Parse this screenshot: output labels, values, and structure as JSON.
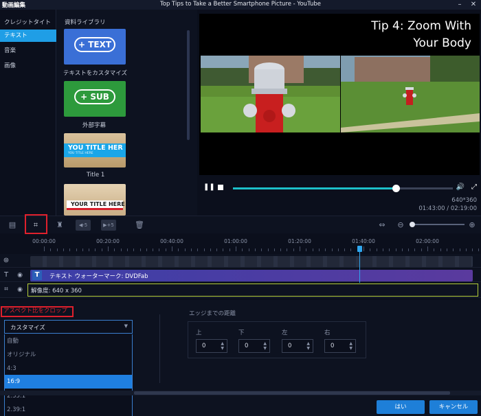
{
  "window": {
    "app_title": "動画編集",
    "title": "Top Tips to Take a Better Smartphone Picture - YouTube"
  },
  "sidebar": {
    "items": [
      {
        "label": "クレジットタイトル"
      },
      {
        "label": "テキスト"
      },
      {
        "label": "音楽"
      },
      {
        "label": "画像"
      }
    ],
    "active_index": 1
  },
  "library": {
    "header": "資料ライブラリ",
    "tiles": [
      {
        "pill": "+ TEXT",
        "caption": "テキストをカスタマイズ"
      },
      {
        "pill": "+ SUB",
        "caption": "外部字幕"
      },
      {
        "main": "YOU TITLE HER",
        "sub": "YOU TITLE HERE",
        "caption": "Title 1"
      },
      {
        "main": "YOUR TITLE HERE"
      }
    ]
  },
  "preview": {
    "overlay_line1": "Tip 4: Zoom With",
    "overlay_line2": "Your Body",
    "resolution": "640*360",
    "time": "01:43:00 / 02:19:00",
    "progress": 0.74
  },
  "timeline": {
    "ticks": [
      "00:00:00",
      "00:20:00",
      "00:40:00",
      "01:00:00",
      "01:20:00",
      "01:40:00",
      "02:00:00"
    ],
    "text_track_label": "テキスト ウォーターマーク: DVDFab",
    "crop_track_label": "解像度: 640 x 360",
    "zoom": 0
  },
  "crop": {
    "title": "アスペクト比をクロップ",
    "dropdown_value": "カスタマイズ",
    "options": [
      "自動",
      "オリジナル",
      "4:3",
      "16:9",
      "2.35:1",
      "2.39:1"
    ],
    "selected_option": "16:9",
    "edge_title": "エッジまでの距離",
    "edges": [
      {
        "label": "上",
        "value": "0"
      },
      {
        "label": "下",
        "value": "0"
      },
      {
        "label": "左",
        "value": "0"
      },
      {
        "label": "右",
        "value": "0"
      }
    ]
  },
  "buttons": {
    "ok": "はい",
    "cancel": "キャンセル"
  }
}
